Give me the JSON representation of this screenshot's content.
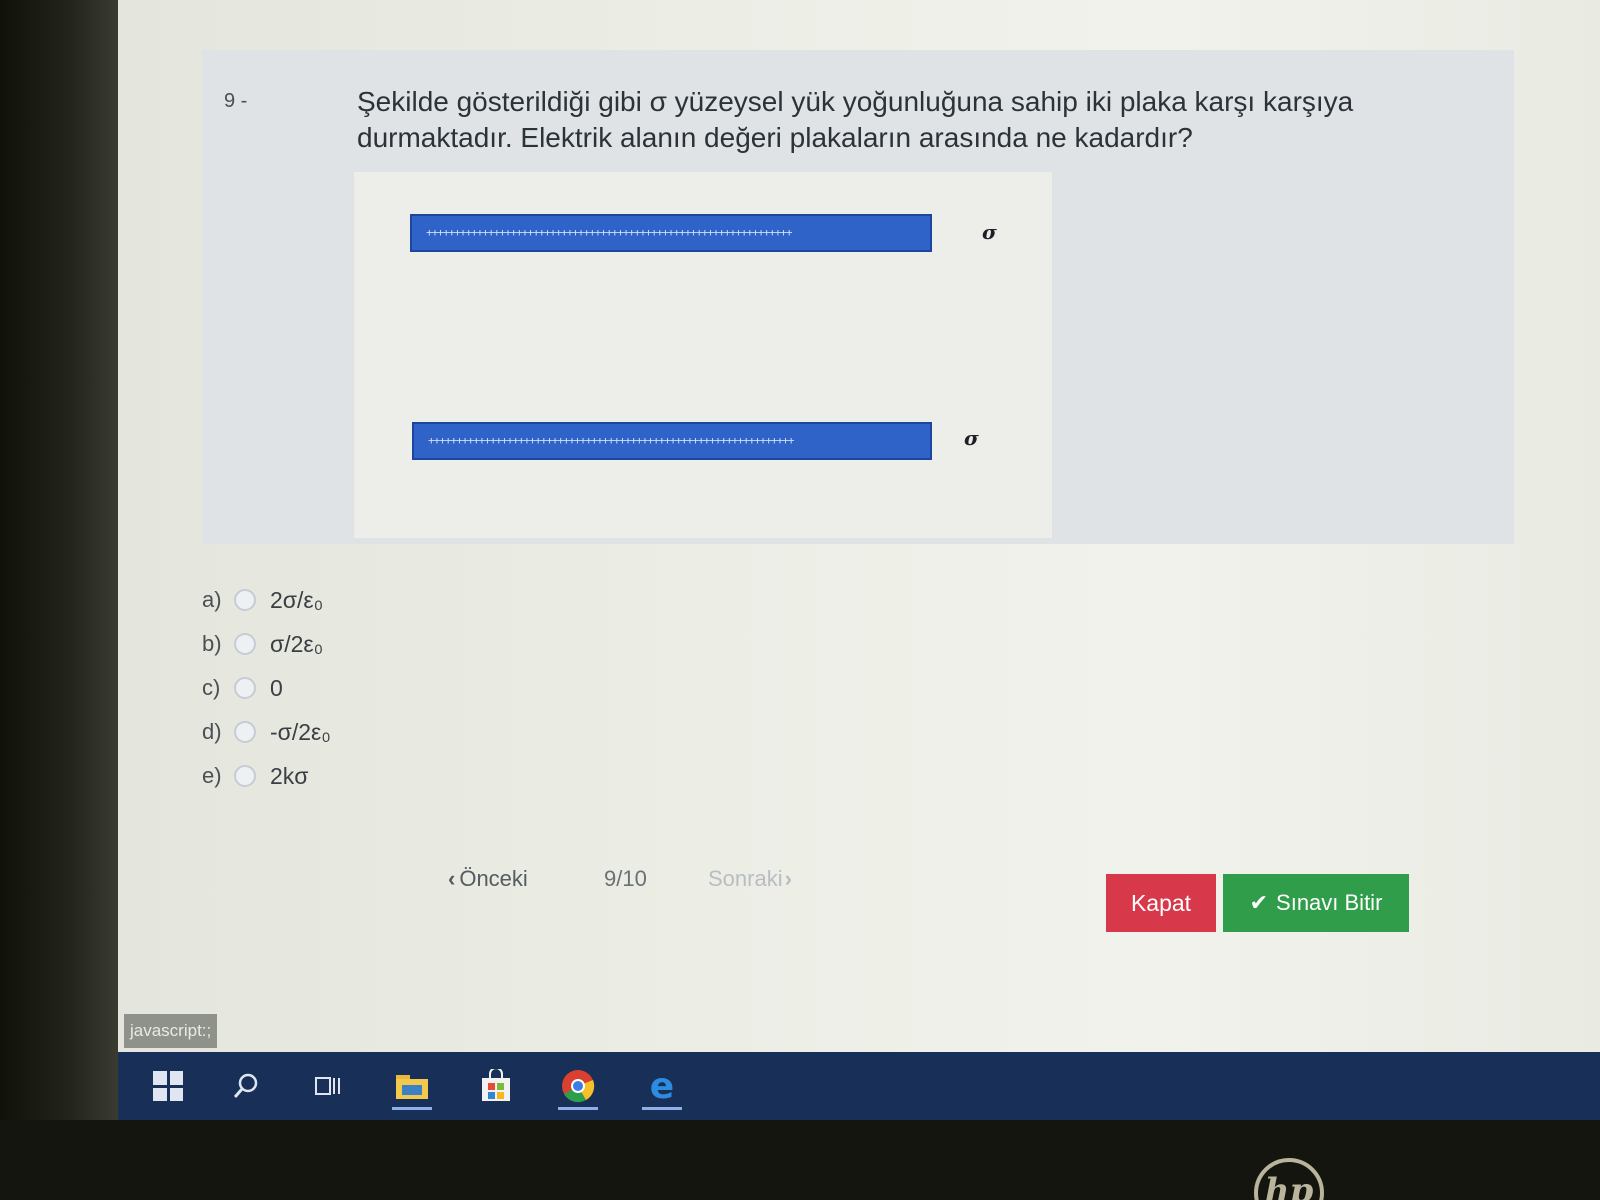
{
  "question": {
    "number": "9 -",
    "text": "Şekilde gösterildiği gibi σ yüzeysel yük yoğunluğuna sahip iki plaka karşı karşıya durmaktadır. Elektrik alanın değeri plakaların arasında ne kadardır?",
    "figure": {
      "top_plate_charges": "+++++++++++++++++++++++++++++++++++++++++++++++++++++++++++++++++",
      "bottom_plate_charges": "+++++++++++++++++++++++++++++++++++++++++++++++++++++++++++++++++",
      "top_label": "σ",
      "bottom_label": "σ"
    }
  },
  "options": [
    {
      "letter": "a)",
      "text": "2σ/ε₀"
    },
    {
      "letter": "b)",
      "text": "σ/2ε₀"
    },
    {
      "letter": "c)",
      "text": "0"
    },
    {
      "letter": "d)",
      "text": "-σ/2ε₀"
    },
    {
      "letter": "e)",
      "text": "2kσ"
    }
  ],
  "navigation": {
    "prev_label": "Önceki",
    "counter": "9/10",
    "next_label": "Sonraki"
  },
  "buttons": {
    "close_label": "Kapat",
    "finish_label": "Sınavı Bitir"
  },
  "status_bar": "javascript:;",
  "colors": {
    "plate": "#2f63c7",
    "close_button": "#d8394a",
    "finish_button": "#2f9d4a",
    "taskbar": "#182f58"
  },
  "taskbar": {
    "icons": [
      "windows-start-icon",
      "search-icon",
      "task-view-icon",
      "file-explorer-icon",
      "store-icon",
      "chrome-icon",
      "edge-icon"
    ]
  },
  "brand": "hp"
}
